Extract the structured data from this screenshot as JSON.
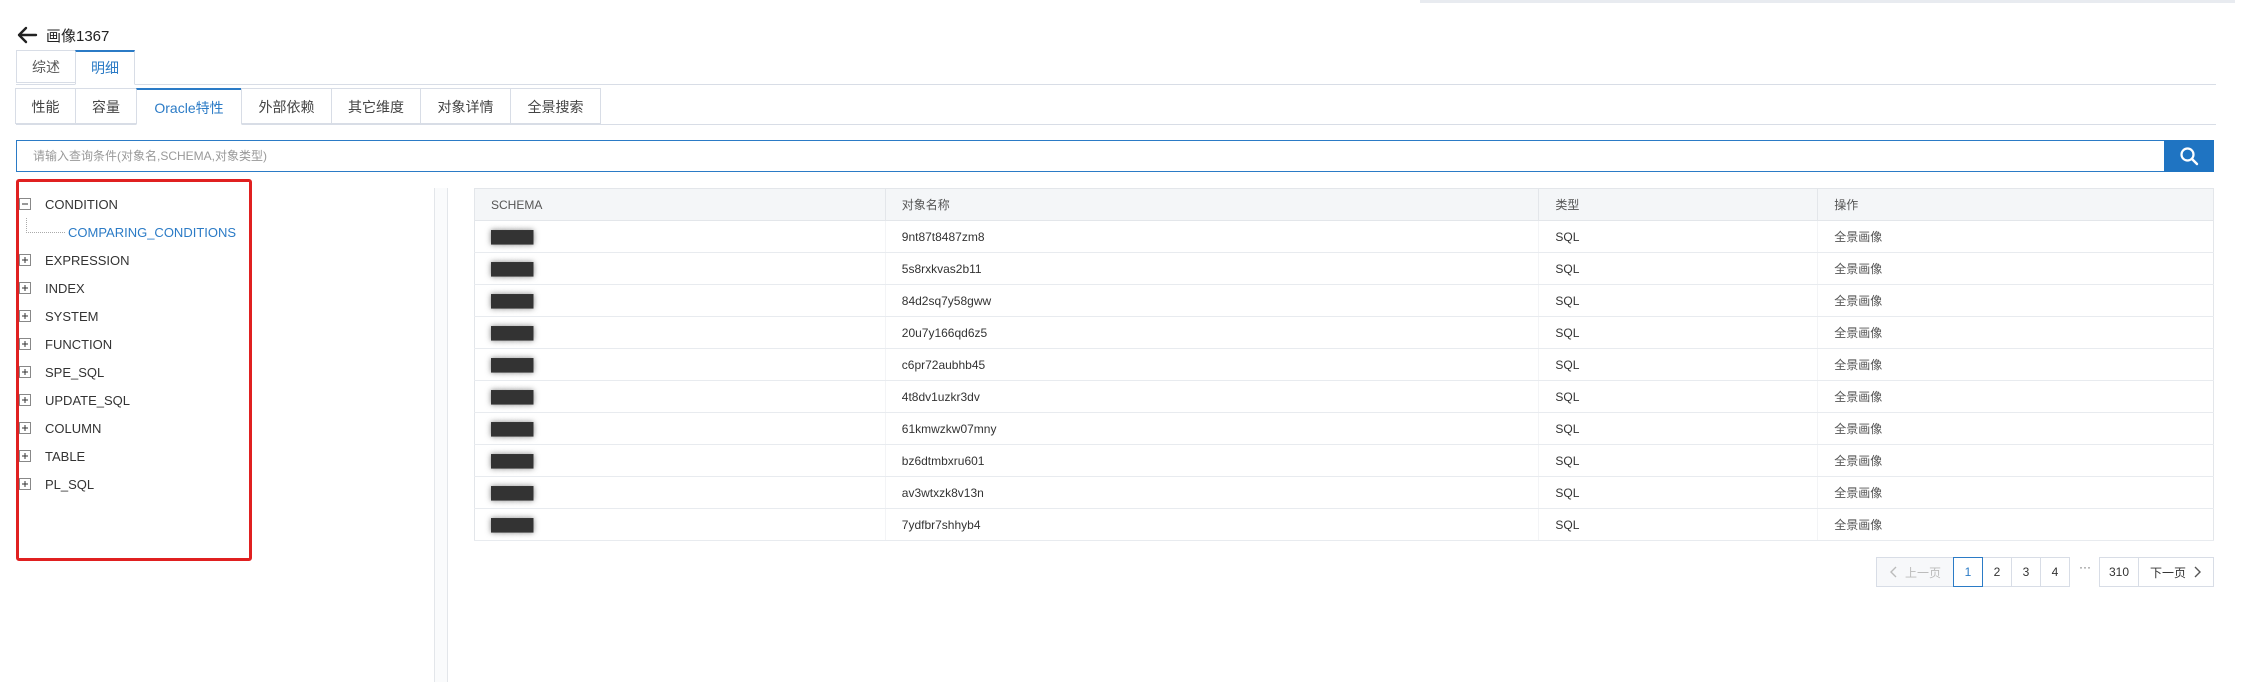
{
  "header": {
    "title": "画像1367"
  },
  "tabs_primary": [
    {
      "label": "综述",
      "active": false
    },
    {
      "label": "明细",
      "active": true
    }
  ],
  "tabs_secondary": [
    {
      "label": "性能",
      "active": false
    },
    {
      "label": "容量",
      "active": false
    },
    {
      "label": "Oracle特性",
      "active": true
    },
    {
      "label": "外部依赖",
      "active": false
    },
    {
      "label": "其它维度",
      "active": false
    },
    {
      "label": "对象详情",
      "active": false
    },
    {
      "label": "全景搜索",
      "active": false
    }
  ],
  "search": {
    "placeholder": "请输入查询条件(对象名,SCHEMA,对象类型)",
    "value": ""
  },
  "tree": {
    "nodes": [
      {
        "label": "CONDITION",
        "expanded": true,
        "children": [
          "COMPARING_CONDITIONS"
        ]
      },
      {
        "label": "EXPRESSION",
        "expanded": false
      },
      {
        "label": "INDEX",
        "expanded": false
      },
      {
        "label": "SYSTEM",
        "expanded": false
      },
      {
        "label": "FUNCTION",
        "expanded": false
      },
      {
        "label": "SPE_SQL",
        "expanded": false
      },
      {
        "label": "UPDATE_SQL",
        "expanded": false
      },
      {
        "label": "COLUMN",
        "expanded": false
      },
      {
        "label": "TABLE",
        "expanded": false
      },
      {
        "label": "PL_SQL",
        "expanded": false
      }
    ]
  },
  "table": {
    "columns": [
      "SCHEMA",
      "对象名称",
      "类型",
      "操作"
    ],
    "rows": [
      {
        "schema": "█████",
        "name": "9nt87t8487zm8",
        "type": "SQL",
        "action": "全景画像"
      },
      {
        "schema": "█████",
        "name": "5s8rxkvas2b11",
        "type": "SQL",
        "action": "全景画像"
      },
      {
        "schema": "█████",
        "name": "84d2sq7y58gww",
        "type": "SQL",
        "action": "全景画像"
      },
      {
        "schema": "█████",
        "name": "20u7y166qd6z5",
        "type": "SQL",
        "action": "全景画像"
      },
      {
        "schema": "█████",
        "name": "c6pr72aubhb45",
        "type": "SQL",
        "action": "全景画像"
      },
      {
        "schema": "█████",
        "name": "4t8dv1uzkr3dv",
        "type": "SQL",
        "action": "全景画像"
      },
      {
        "schema": "█████",
        "name": "61kmwzkw07mny",
        "type": "SQL",
        "action": "全景画像"
      },
      {
        "schema": "█████",
        "name": "bz6dtmbxru601",
        "type": "SQL",
        "action": "全景画像"
      },
      {
        "schema": "█████",
        "name": "av3wtxzk8v13n",
        "type": "SQL",
        "action": "全景画像"
      },
      {
        "schema": "█████",
        "name": "7ydfbr7shhyb4",
        "type": "SQL",
        "action": "全景画像"
      }
    ]
  },
  "pagination": {
    "prev_label": "上一页",
    "next_label": "下一页",
    "pages": [
      "1",
      "2",
      "3",
      "4"
    ],
    "ellipsis": "···",
    "last_page": "310",
    "current": "1"
  },
  "colors": {
    "accent": "#2b7bc6",
    "search_button": "#1f74c2",
    "highlight_border": "#e02020"
  },
  "icons": {
    "back": "arrow-left-icon",
    "search": "search-icon",
    "tree_expand": "plus-square-icon",
    "tree_collapse": "minus-square-icon",
    "prev": "chevron-left-icon",
    "next": "chevron-right-icon"
  }
}
